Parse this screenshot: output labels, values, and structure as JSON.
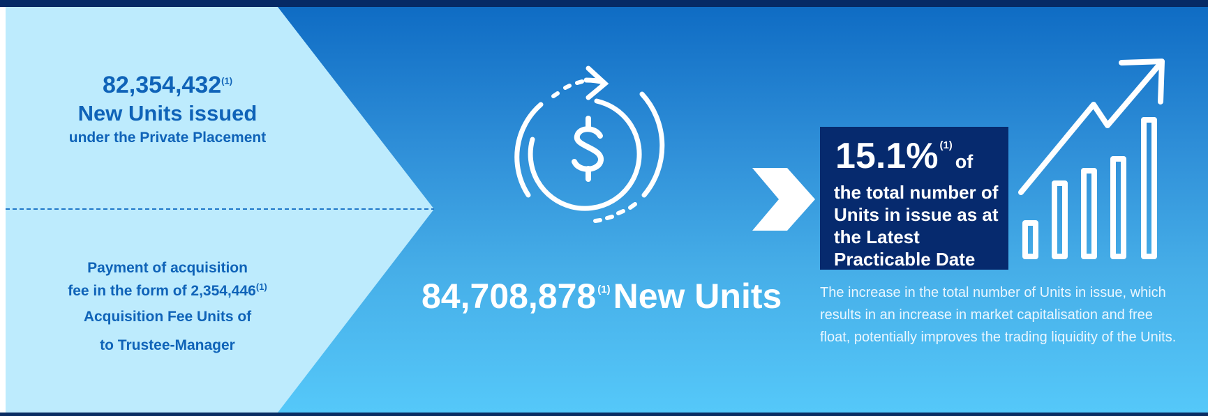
{
  "left_top": {
    "number": "82,354,432",
    "footnote": "(1)",
    "line1": "New Units issued",
    "line2": "under the Private Placement"
  },
  "left_bottom": {
    "line1": "Payment of acquisition",
    "line2": "fee in the form of 2,354,446",
    "footnote": "(1)",
    "line3": "Acquisition Fee Units of",
    "line4": "to Trustee-Manager"
  },
  "center": {
    "number": "84,708,878",
    "footnote": "(1)",
    "label": "New Units",
    "icon": "dollar-cycle-icon"
  },
  "stat": {
    "percent": "15.1%",
    "footnote": "(1)",
    "of": "of",
    "description": "the total number of Units in issue as at the Latest Practicable Date"
  },
  "paragraph": "The increase in the total number of Units in issue, which results in an increase in market capitalisation and free float, potentially improves the trading liquidity of the Units.",
  "icons": {
    "arrow": "chevron-right-icon",
    "growth": "growth-chart-icon"
  },
  "colors": {
    "accent_dark": "#062a6e",
    "left_panel": "#bfeafc",
    "text_blue": "#0f63b8"
  }
}
